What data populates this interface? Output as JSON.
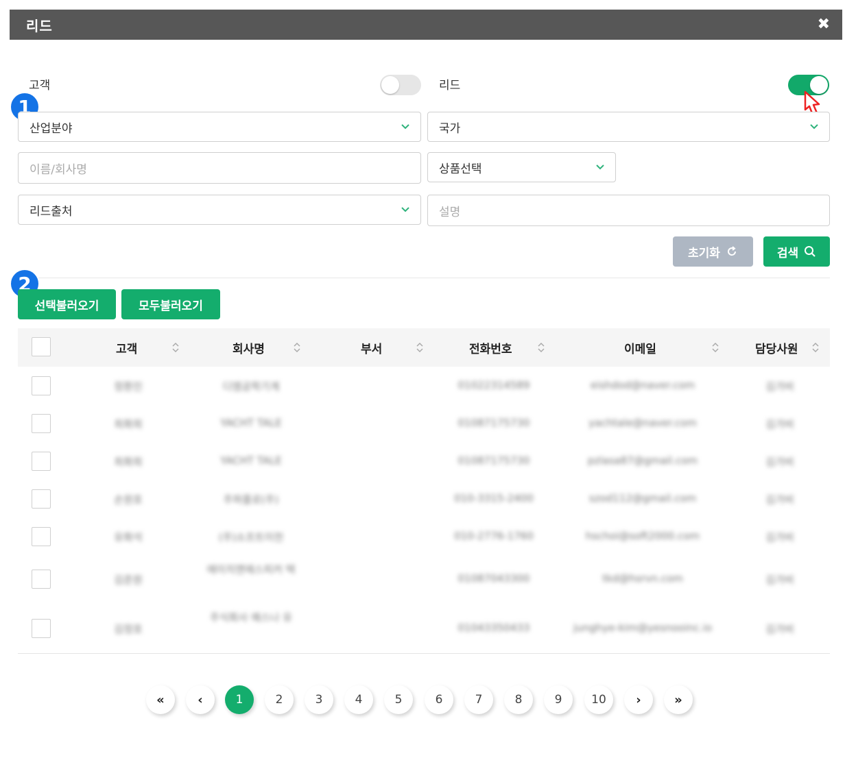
{
  "window": {
    "title": "리드",
    "close_icon": "close-icon"
  },
  "filters": {
    "customer_label": "고객",
    "lead_label": "리드",
    "customer_toggle_on": false,
    "lead_toggle_on": true,
    "industry_select": "산업분야",
    "country_select": "국가",
    "name_placeholder": "이름/회사명",
    "product_select": "상품선택",
    "lead_source_select": "리드출처",
    "description_placeholder": "설명",
    "reset_label": "초기화",
    "search_label": "검색"
  },
  "badges": {
    "one": "1",
    "two": "2"
  },
  "actions": {
    "load_selected": "선택불러오기",
    "load_all": "모두불러오기"
  },
  "table": {
    "columns": [
      "고객",
      "회사명",
      "부서",
      "전화번호",
      "이메일",
      "담당사원"
    ],
    "rows": [
      {
        "customer": "정환진",
        "company": "디엠공학기계",
        "dept": "",
        "phone": "01022314589",
        "email": "eishdod@naver.com",
        "owner": "김가비"
      },
      {
        "customer": "최화희",
        "company": "YACHT TALE",
        "dept": "",
        "phone": "01087175730",
        "email": "yachtale@naver.com",
        "owner": "김가비"
      },
      {
        "customer": "최화희",
        "company": "YACHT TALE",
        "dept": "",
        "phone": "01087175730",
        "email": "pzlasa87@gmail.com",
        "owner": "김가비"
      },
      {
        "customer": "손원호",
        "company": "주파플로(주)",
        "dept": "",
        "phone": "010-3315-2400",
        "email": "szod112@gmail.com",
        "owner": "김가비"
      },
      {
        "customer": "유화석",
        "company": "(주)소프트이천",
        "dept": "",
        "phone": "010-2776-1760",
        "email": "hschoi@soft2000.com",
        "owner": "김가비"
      },
      {
        "customer": "김준원",
        "company": "에이치앤에스피커 텍",
        "dept": "",
        "phone": "01087043300",
        "email": "tkd@hsrvn.com",
        "owner": "김가비"
      },
      {
        "customer": "김정호",
        "company": "주식회사 예스나 유",
        "dept": "",
        "phone": "01043350433",
        "email": "junghye-kim@yesnooinc.io",
        "owner": "김가비"
      }
    ]
  },
  "pagination": {
    "first": "«",
    "prev": "‹",
    "next": "›",
    "last": "»",
    "pages": [
      "1",
      "2",
      "3",
      "4",
      "5",
      "6",
      "7",
      "8",
      "9",
      "10"
    ],
    "current": "1"
  },
  "colors": {
    "accent": "#14ad6d",
    "titlebar": "#575757",
    "badge": "#1473e6",
    "reset": "#aeb7c3"
  }
}
